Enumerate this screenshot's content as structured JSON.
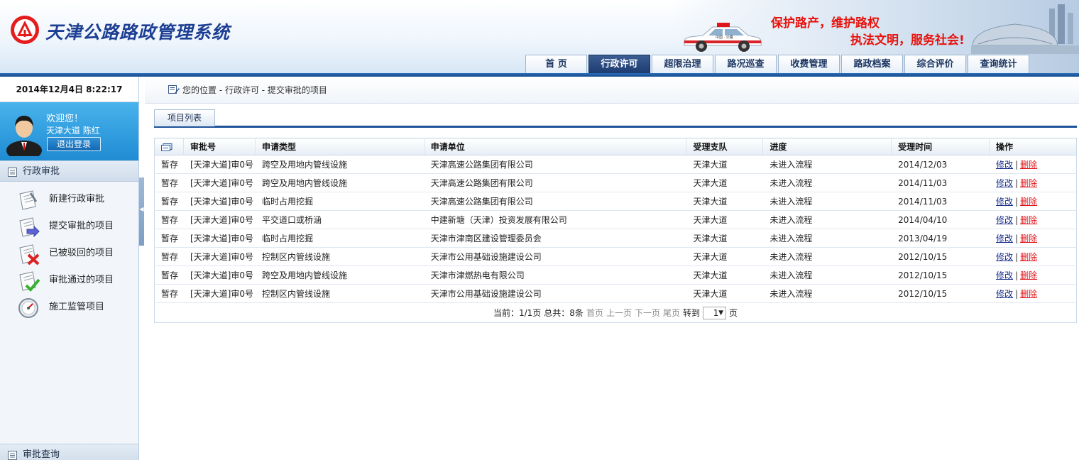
{
  "header": {
    "system_title": "天津公路路政管理系统",
    "slogan_line1": "保护路产，维护路权",
    "slogan_line2": "执法文明，服务社会!",
    "car_text": "中国 · 公路",
    "nav_tabs": [
      {
        "label": "首 页",
        "active": false
      },
      {
        "label": "行政许可",
        "active": true
      },
      {
        "label": "超限治理",
        "active": false
      },
      {
        "label": "路况巡查",
        "active": false
      },
      {
        "label": "收费管理",
        "active": false
      },
      {
        "label": "路政档案",
        "active": false
      },
      {
        "label": "综合评价",
        "active": false
      },
      {
        "label": "查询统计",
        "active": false
      }
    ]
  },
  "sidebar": {
    "datetime": "2014年12月4日 8:22:17",
    "welcome": "欢迎您！",
    "user": "天津大道 陈红",
    "logout_label": "退出登录",
    "section_title": "行政审批",
    "items": [
      {
        "label": "新建行政审批",
        "icon": "new-form-icon"
      },
      {
        "label": "提交审批的项目",
        "icon": "submit-arrow-icon"
      },
      {
        "label": "已被驳回的项目",
        "icon": "rejected-x-icon"
      },
      {
        "label": "审批通过的项目",
        "icon": "approved-check-icon"
      },
      {
        "label": "施工监管项目",
        "icon": "gauge-icon"
      }
    ],
    "bottom_section": "审批查询"
  },
  "content": {
    "breadcrumb": "您的位置 - 行政许可 - 提交审批的项目",
    "tab_label": "项目列表",
    "columns": [
      "审批号",
      "申请类型",
      "申请单位",
      "受理支队",
      "进度",
      "受理时间",
      "操作"
    ],
    "rows": [
      [
        "暂存",
        "[天津大道]审0号",
        "跨空及用地内管线设施",
        "天津高速公路集团有限公司",
        "天津大道",
        "未进入流程",
        "2014/12/03"
      ],
      [
        "暂存",
        "[天津大道]审0号",
        "跨空及用地内管线设施",
        "天津高速公路集团有限公司",
        "天津大道",
        "未进入流程",
        "2014/11/03"
      ],
      [
        "暂存",
        "[天津大道]审0号",
        "临时占用挖掘",
        "天津高速公路集团有限公司",
        "天津大道",
        "未进入流程",
        "2014/11/03"
      ],
      [
        "暂存",
        "[天津大道]审0号",
        "平交道口或桥涵",
        "中建新塘（天津）投资发展有限公司",
        "天津大道",
        "未进入流程",
        "2014/04/10"
      ],
      [
        "暂存",
        "[天津大道]审0号",
        "临时占用挖掘",
        "天津市津南区建设管理委员会",
        "天津大道",
        "未进入流程",
        "2013/04/19"
      ],
      [
        "暂存",
        "[天津大道]审0号",
        "控制区内管线设施",
        "天津市公用基础设施建设公司",
        "天津大道",
        "未进入流程",
        "2012/10/15"
      ],
      [
        "暂存",
        "[天津大道]审0号",
        "跨空及用地内管线设施",
        "天津市津燃热电有限公司",
        "天津大道",
        "未进入流程",
        "2012/10/15"
      ],
      [
        "暂存",
        "[天津大道]审0号",
        "控制区内管线设施",
        "天津市公用基础设施建设公司",
        "天津大道",
        "未进入流程",
        "2012/10/15"
      ]
    ],
    "action_edit": "修改",
    "action_separator": "|",
    "action_delete": "删除",
    "pager": {
      "current": "当前：1/1页",
      "total": "总共：8条",
      "first": "首页",
      "prev": "上一页",
      "next": "下一页",
      "last": "尾页",
      "goto": "转到",
      "page_value": "1",
      "page_unit": "页"
    }
  },
  "colors": {
    "nav_active": "#1d3b70",
    "header_bar": "#164a8c",
    "slogan": "#e8120c",
    "user_panel": "#1f8bd3",
    "delete_link": "#e0141a",
    "edit_link": "#1a2f8a"
  }
}
